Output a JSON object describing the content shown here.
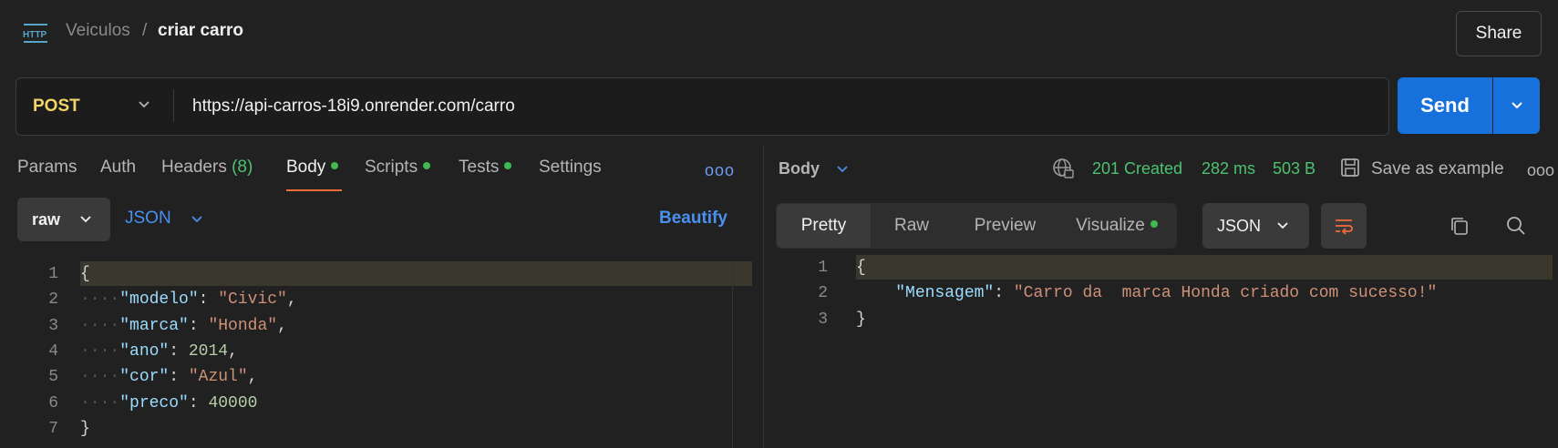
{
  "header": {
    "icon": "http-icon",
    "icon_text": "HTTP",
    "breadcrumb_parent": "Veiculos",
    "breadcrumb_sep": "/",
    "breadcrumb_current": "criar carro",
    "share_label": "Share"
  },
  "request": {
    "method": "POST",
    "url": "https://api-carros-18i9.onrender.com/carro",
    "send_label": "Send"
  },
  "request_tabs": [
    {
      "label": "Params"
    },
    {
      "label": "Auth"
    },
    {
      "label": "Headers",
      "count": "(8)"
    },
    {
      "label": "Body",
      "dot": true,
      "active": true
    },
    {
      "label": "Scripts",
      "dot": true
    },
    {
      "label": "Tests",
      "dot": true
    },
    {
      "label": "Settings"
    }
  ],
  "more_label": "ooo",
  "body_mode": {
    "mode": "raw",
    "language": "JSON",
    "beautify_label": "Beautify"
  },
  "request_body_lines": [
    {
      "num": "1",
      "text": "{"
    },
    {
      "num": "2",
      "key": "\"modelo\"",
      "value": "\"Civic\"",
      "kind": "s",
      "trail": ","
    },
    {
      "num": "3",
      "key": "\"marca\"",
      "value": "\"Honda\"",
      "kind": "s",
      "trail": ","
    },
    {
      "num": "4",
      "key": "\"ano\"",
      "value": "2014",
      "kind": "n",
      "trail": ","
    },
    {
      "num": "5",
      "key": "\"cor\"",
      "value": "\"Azul\"",
      "kind": "s",
      "trail": ","
    },
    {
      "num": "6",
      "key": "\"preco\"",
      "value": "40000",
      "kind": "n",
      "trail": ""
    },
    {
      "num": "7",
      "text": "}"
    }
  ],
  "response": {
    "body_label": "Body",
    "status": "201 Created",
    "time": "282 ms",
    "size": "503 B",
    "save_label": "Save as example",
    "view_tabs": [
      "Pretty",
      "Raw",
      "Preview",
      "Visualize"
    ],
    "format": "JSON",
    "lines": [
      {
        "num": "1",
        "text": "{"
      },
      {
        "num": "2",
        "key": "\"Mensagem\"",
        "value": "\"Carro da  marca Honda criado com sucesso!\""
      },
      {
        "num": "3",
        "text": "}"
      }
    ]
  },
  "colors": {
    "accent": "#1671dd",
    "method": "#f3d46a",
    "success": "#4cc270",
    "active_tab_underline": "#f26b3a"
  }
}
